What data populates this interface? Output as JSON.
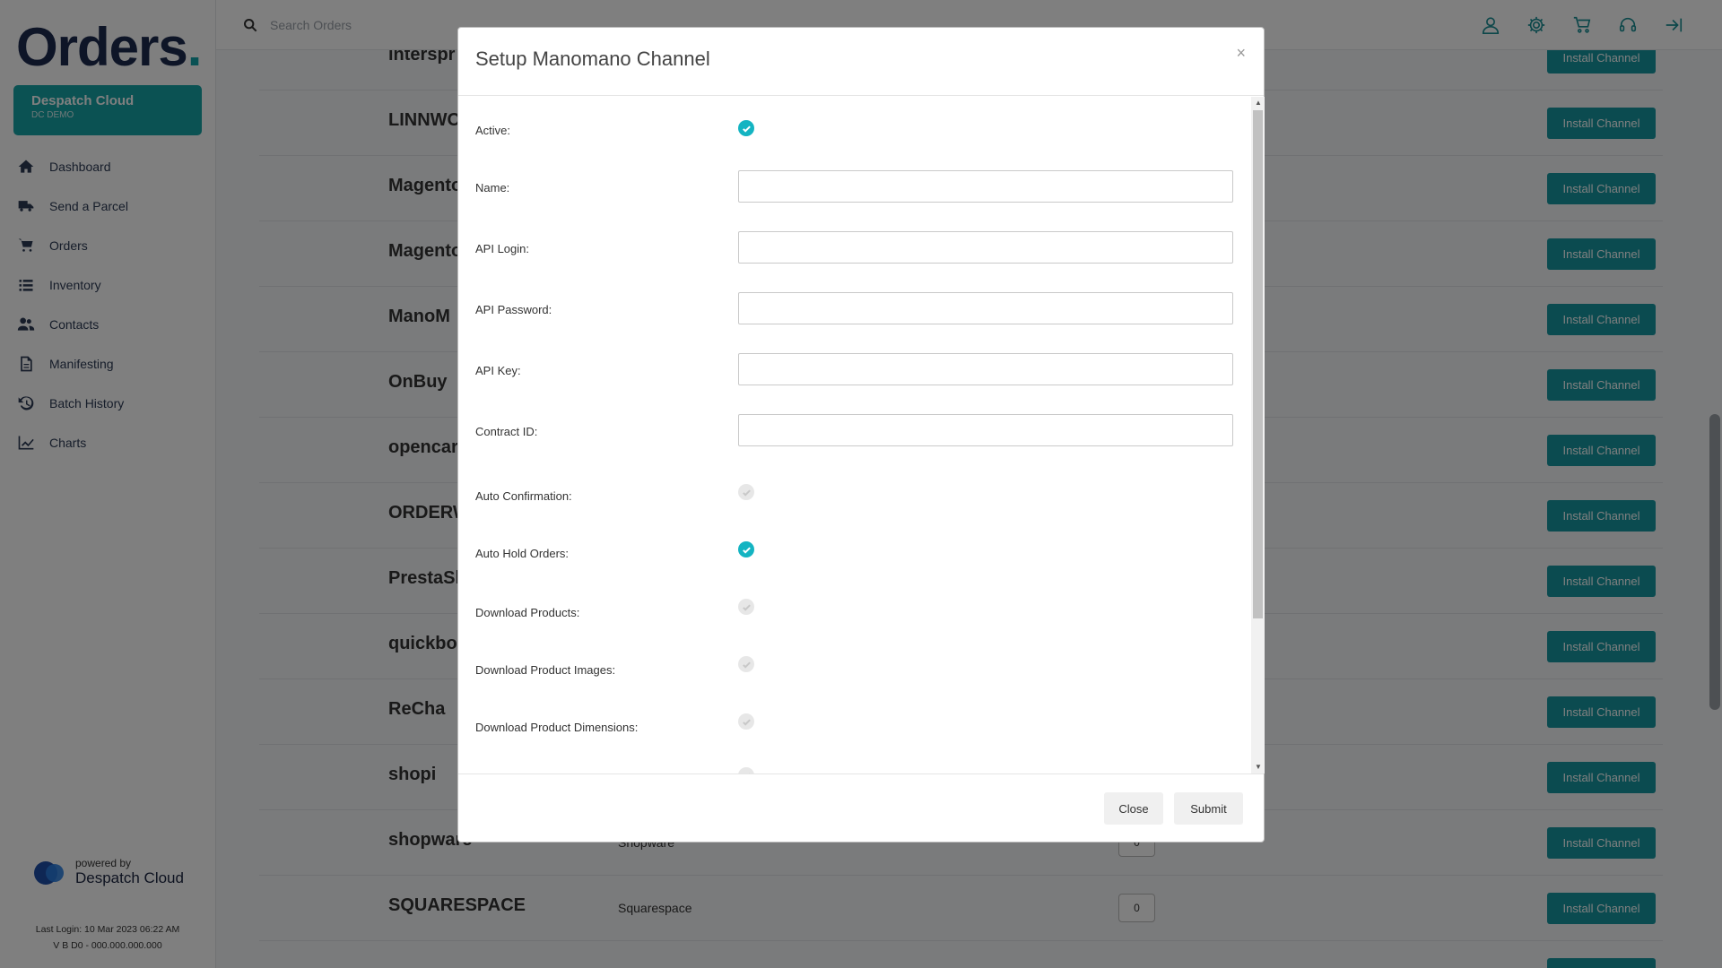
{
  "sidebar": {
    "logo_text": "Orders",
    "logo_dot": ".",
    "account": {
      "name": "Despatch Cloud",
      "sub": "DC DEMO"
    },
    "nav": [
      {
        "label": "Dashboard",
        "icon": "home-icon"
      },
      {
        "label": "Send a Parcel",
        "icon": "truck-icon"
      },
      {
        "label": "Orders",
        "icon": "cart-icon"
      },
      {
        "label": "Inventory",
        "icon": "list-icon"
      },
      {
        "label": "Contacts",
        "icon": "users-icon"
      },
      {
        "label": "Manifesting",
        "icon": "document-icon"
      },
      {
        "label": "Batch History",
        "icon": "history-icon"
      },
      {
        "label": "Charts",
        "icon": "chart-icon"
      }
    ],
    "powered_by": "powered by",
    "powered_brand": "Despatch Cloud",
    "last_login": "Last Login: 10 Mar 2023 06:22 AM",
    "version": "V B D0 - 000.000.000.000"
  },
  "topbar": {
    "search_placeholder": "Search Orders",
    "icons": [
      "user-icon",
      "gear-icon",
      "cart-icon",
      "headset-icon",
      "logout-icon"
    ]
  },
  "channels": {
    "install_label": "Install Channel",
    "rows": [
      {
        "brand": "interspr",
        "name": "",
        "count": ""
      },
      {
        "brand": "LINNWOR",
        "name": "",
        "count": ""
      },
      {
        "brand": "Magento",
        "name": "",
        "count": ""
      },
      {
        "brand": "Magento",
        "name": "",
        "count": ""
      },
      {
        "brand": "ManoM",
        "name": "",
        "count": ""
      },
      {
        "brand": "OnBuy",
        "name": "",
        "count": ""
      },
      {
        "brand": "opencart",
        "name": "",
        "count": ""
      },
      {
        "brand": "ORDERWI",
        "name": "",
        "count": ""
      },
      {
        "brand": "PrestaSh",
        "name": "",
        "count": ""
      },
      {
        "brand": "quickbo",
        "name": "",
        "count": ""
      },
      {
        "brand": "ReCha",
        "name": "",
        "count": ""
      },
      {
        "brand": "shopi",
        "name": "",
        "count": ""
      },
      {
        "brand": "shopware",
        "name": "Shopware",
        "count": "0"
      },
      {
        "brand": "SQUARESPACE",
        "name": "Squarespace",
        "count": "0"
      },
      {
        "brand": "",
        "name": "",
        "count": ""
      }
    ]
  },
  "modal": {
    "title": "Setup Manomano Channel",
    "close_x": "×",
    "fields": {
      "active": {
        "label": "Active:",
        "checked": true
      },
      "name": {
        "label": "Name:",
        "value": ""
      },
      "api_login": {
        "label": "API Login:",
        "value": ""
      },
      "api_password": {
        "label": "API Password:",
        "value": ""
      },
      "api_key": {
        "label": "API Key:",
        "value": ""
      },
      "contract_id": {
        "label": "Contract ID:",
        "value": ""
      },
      "auto_confirmation": {
        "label": "Auto Confirmation:",
        "checked": false
      },
      "auto_hold_orders": {
        "label": "Auto Hold Orders:",
        "checked": true
      },
      "download_products": {
        "label": "Download Products:",
        "checked": false
      },
      "download_product_images": {
        "label": "Download Product Images:",
        "checked": false
      },
      "download_product_dimensions": {
        "label": "Download Product Dimensions:",
        "checked": false
      }
    },
    "close_button": "Close",
    "submit_button": "Submit"
  },
  "colors": {
    "accent": "#1797a1",
    "checkbox_checked": "#14b4c2",
    "brand_navy": "#1d2b4f"
  }
}
